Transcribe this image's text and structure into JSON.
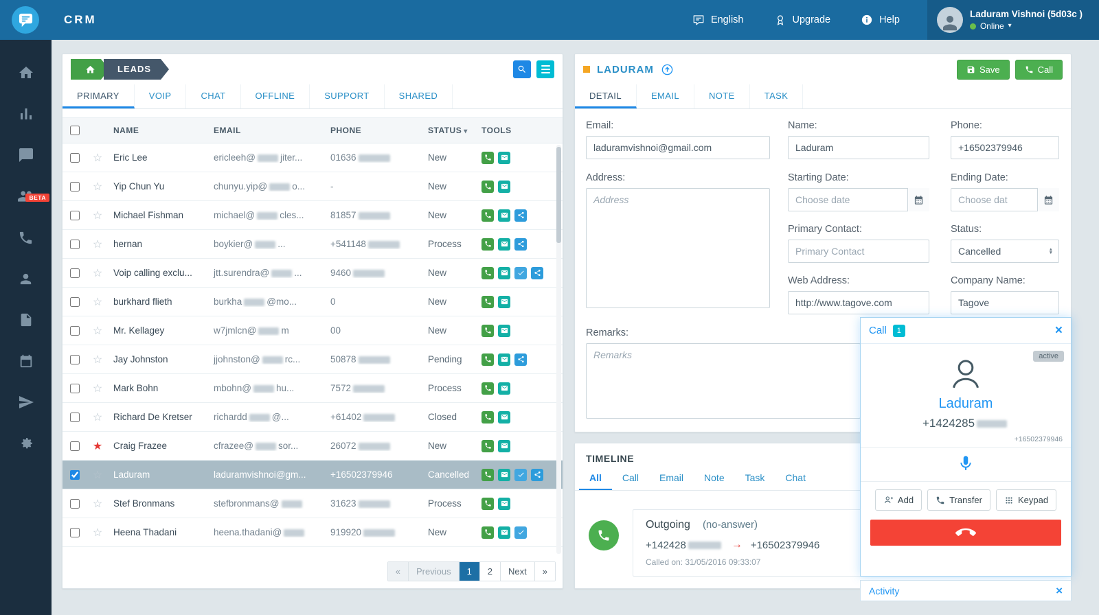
{
  "colors": {
    "topbar": "#1a6ba0",
    "sidebar": "#1b2e3f",
    "accent_blue": "#2196f3",
    "link_blue": "#2a8fc7",
    "green": "#4caf50",
    "red": "#f44336",
    "cyan": "#00bcd4",
    "orange": "#f5a623",
    "selected_row": "#a9bcc6",
    "tool_call": "#43a047",
    "tool_email": "#14b0a6",
    "tool_check": "#41a7e0",
    "tool_share": "#2d9cdb"
  },
  "topbar": {
    "app_name": "CRM",
    "language_label": "English",
    "upgrade_label": "Upgrade",
    "help_label": "Help",
    "user_name": "Laduram Vishnoi (5d03c )",
    "user_status": "Online"
  },
  "sidebar": {
    "icons": [
      "home",
      "stats",
      "chat",
      "team",
      "phone",
      "contact",
      "document",
      "calendar",
      "send",
      "settings"
    ],
    "beta_badge": "BETA"
  },
  "leads": {
    "title": "LEADS",
    "tabs": [
      "PRIMARY",
      "VOIP",
      "CHAT",
      "OFFLINE",
      "SUPPORT",
      "SHARED"
    ],
    "columns": {
      "name": "NAME",
      "email": "EMAIL",
      "phone": "PHONE",
      "status": "STATUS",
      "tools": "TOOLS"
    },
    "rows": [
      {
        "name": "Eric Lee",
        "email": {
          "pre": "ericleeh@",
          "blur": true,
          "post": "jiter..."
        },
        "phone": {
          "pre": "01636",
          "blur": true
        },
        "status": "New",
        "tools": [
          "call",
          "email"
        ]
      },
      {
        "name": "Yip Chun Yu",
        "email": {
          "pre": "chunyu.yip@",
          "blur": true,
          "post": "o..."
        },
        "phone": {
          "pre": "-"
        },
        "status": "New",
        "tools": [
          "call",
          "email"
        ]
      },
      {
        "name": "Michael Fishman",
        "email": {
          "pre": "michael@",
          "blur": true,
          "post": "cles..."
        },
        "phone": {
          "pre": "81857",
          "blur": true
        },
        "status": "New",
        "tools": [
          "call",
          "email",
          "share"
        ]
      },
      {
        "name": "hernan",
        "email": {
          "pre": "boykier@",
          "blur": true,
          "post": "..."
        },
        "phone": {
          "pre": "+541148",
          "blur": true
        },
        "status": "Process",
        "tools": [
          "call",
          "email",
          "share"
        ]
      },
      {
        "name": "Voip calling exclu...",
        "email": {
          "pre": "jtt.surendra@",
          "blur": true,
          "post": "..."
        },
        "phone": {
          "pre": "9460",
          "blur": true
        },
        "status": "New",
        "tools": [
          "call",
          "email",
          "check",
          "share"
        ]
      },
      {
        "name": "burkhard flieth",
        "email": {
          "pre": "burkha",
          "blur": true,
          "post": "@mo..."
        },
        "phone": {
          "pre": "0"
        },
        "status": "New",
        "tools": [
          "call",
          "email"
        ]
      },
      {
        "name": "Mr. Kellagey",
        "email": {
          "pre": "w7jmlcn@",
          "blur": true,
          "post": "m"
        },
        "phone": {
          "pre": "00"
        },
        "status": "New",
        "tools": [
          "call",
          "email"
        ]
      },
      {
        "name": "Jay Johnston",
        "email": {
          "pre": "jjohnston@",
          "blur": true,
          "post": "rc..."
        },
        "phone": {
          "pre": "50878",
          "blur": true
        },
        "status": "Pending",
        "tools": [
          "call",
          "email",
          "share"
        ]
      },
      {
        "name": "Mark Bohn",
        "email": {
          "pre": "mbohn@",
          "blur": true,
          "post": "hu..."
        },
        "phone": {
          "pre": "7572",
          "blur": true
        },
        "status": "Process",
        "tools": [
          "call",
          "email"
        ]
      },
      {
        "name": "Richard De Kretser",
        "email": {
          "pre": "richardd",
          "blur": true,
          "post": "@..."
        },
        "phone": {
          "pre": "+61402",
          "blur": true
        },
        "status": "Closed",
        "tools": [
          "call",
          "email"
        ]
      },
      {
        "name": "Craig Frazee",
        "starred": true,
        "email": {
          "pre": "cfrazee@",
          "blur": true,
          "post": "sor..."
        },
        "phone": {
          "pre": "26072",
          "blur": true
        },
        "status": "New",
        "tools": [
          "call",
          "email"
        ]
      },
      {
        "name": "Laduram",
        "checked": true,
        "selected": true,
        "email": {
          "pre": "laduramvishnoi@gm..."
        },
        "phone": {
          "pre": "+16502379946"
        },
        "status": "Cancelled",
        "tools": [
          "call",
          "email",
          "check",
          "share"
        ]
      },
      {
        "name": "Stef Bronmans",
        "email": {
          "pre": "stefbronmans@",
          "blur": true
        },
        "phone": {
          "pre": "31623",
          "blur": true
        },
        "status": "Process",
        "tools": [
          "call",
          "email"
        ]
      },
      {
        "name": "Heena Thadani",
        "email": {
          "pre": "heena.thadani@",
          "blur": true
        },
        "phone": {
          "pre": "919920",
          "blur": true
        },
        "status": "New",
        "tools": [
          "call",
          "email",
          "check"
        ]
      },
      {
        "partial": true
      }
    ],
    "pagination": {
      "prev_icon": "«",
      "previous_label": "Previous",
      "pages": [
        "1",
        "2"
      ],
      "active_page": "1",
      "next_label": "Next",
      "next_icon": "»"
    }
  },
  "detail": {
    "title": "LADURAM",
    "save_label": "Save",
    "call_label": "Call",
    "tabs": [
      "DETAIL",
      "EMAIL",
      "NOTE",
      "TASK"
    ],
    "fields": {
      "email": {
        "label": "Email:",
        "value": "laduramvishnoi@gmail.com"
      },
      "address": {
        "label": "Address:",
        "placeholder": "Address"
      },
      "remarks": {
        "label": "Remarks:",
        "placeholder": "Remarks"
      },
      "name": {
        "label": "Name:",
        "value": "Laduram"
      },
      "starting_date": {
        "label": "Starting Date:",
        "placeholder": "Choose date"
      },
      "primary_contact": {
        "label": "Primary Contact:",
        "placeholder": "Primary Contact"
      },
      "web_address": {
        "label": "Web Address:",
        "value": "http://www.tagove.com"
      },
      "phone": {
        "label": "Phone:",
        "value": "+16502379946"
      },
      "ending_date": {
        "label": "Ending Date:",
        "placeholder": "Choose dat"
      },
      "status": {
        "label": "Status:",
        "value": "Cancelled"
      },
      "company_name": {
        "label": "Company Name:",
        "value": "Tagove"
      }
    }
  },
  "timeline": {
    "title": "TIMELINE",
    "tabs": [
      "All",
      "Call",
      "Email",
      "Note",
      "Task",
      "Chat"
    ],
    "entry": {
      "direction": "Outgoing",
      "result": "(no-answer)",
      "from": "+142428",
      "to": "+16502379946",
      "called_on": "Called on: 31/05/2016 09:33:07"
    }
  },
  "call_widget": {
    "title": "Call",
    "badge": "1",
    "status_badge": "active",
    "contact_name": "Laduram",
    "number": "+1424285",
    "secondary_number": "+16502379946",
    "add_label": "Add",
    "transfer_label": "Transfer",
    "keypad_label": "Keypad",
    "activity_label": "Activity"
  }
}
